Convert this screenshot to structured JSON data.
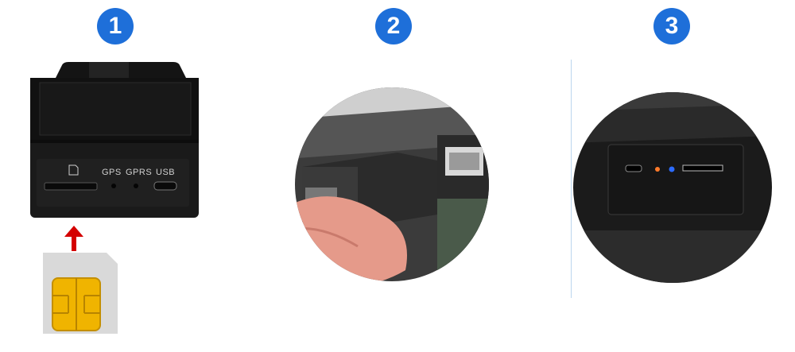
{
  "steps": [
    {
      "number": "1"
    },
    {
      "number": "2"
    },
    {
      "number": "3"
    }
  ],
  "device": {
    "port_labels": [
      "GPS",
      "GPRS",
      "USB"
    ]
  },
  "colors": {
    "badge": "#1e6fd9",
    "arrow": "#d40000",
    "device_body": "#1a1a1a",
    "sim_chip": "#f0b400",
    "led_orange": "#ff7a2a",
    "led_blue": "#2c6bff"
  }
}
